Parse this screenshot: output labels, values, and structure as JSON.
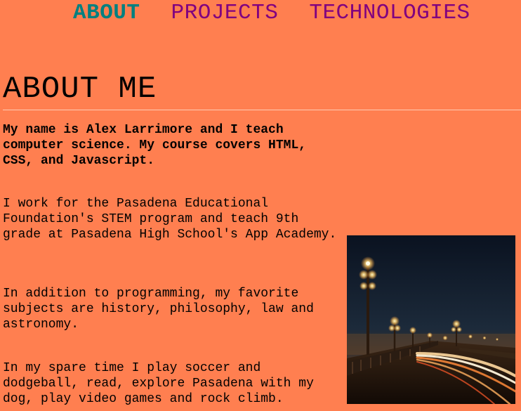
{
  "nav": {
    "items": [
      {
        "label": "ABOUT",
        "active": true
      },
      {
        "label": "PROJECTS",
        "active": false
      },
      {
        "label": "TECHNOLOGIES",
        "active": false
      }
    ],
    "active_color": "#008080",
    "link_color": "#800080"
  },
  "page": {
    "title": "ABOUT ME",
    "background_color": "#ff7f50"
  },
  "paragraphs": [
    "My name is Alex Larrimore and I teach computer science. My course covers HTML, CSS, and Javascript.",
    "I work for the Pasadena Educational Foundation's STEM program and teach 9th grade at Pasadena High School's App Academy.",
    "In addition to programming, my favorite subjects are history, philosophy, law and astronomy.",
    "In my spare time I play soccer and dodgeball, read, explore Pasadena with my dog, play video games and rock climb."
  ],
  "photo": {
    "subject": "bridge-at-night-photo"
  }
}
